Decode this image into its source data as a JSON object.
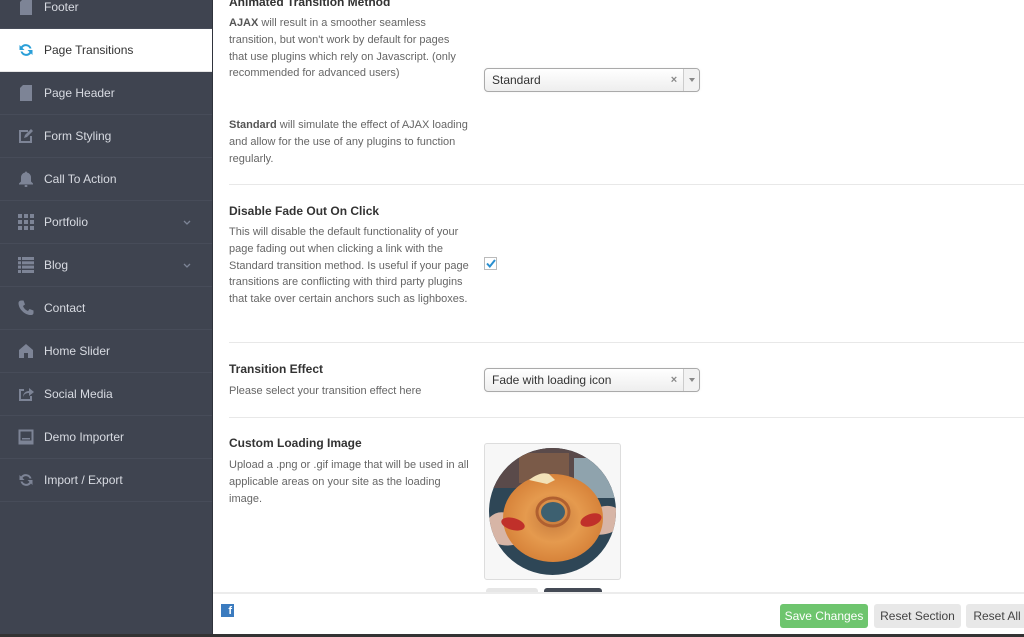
{
  "sidebar": {
    "items": [
      {
        "label": "Footer",
        "icon": "page-icon",
        "active": false
      },
      {
        "label": "Page Transitions",
        "icon": "refresh-icon",
        "active": true
      },
      {
        "label": "Page Header",
        "icon": "page-icon",
        "active": false
      },
      {
        "label": "Form Styling",
        "icon": "edit-icon",
        "active": false
      },
      {
        "label": "Call To Action",
        "icon": "bell-icon",
        "active": false
      },
      {
        "label": "Portfolio",
        "icon": "grid-icon",
        "active": false,
        "expandable": true
      },
      {
        "label": "Blog",
        "icon": "list-icon",
        "active": false,
        "expandable": true
      },
      {
        "label": "Contact",
        "icon": "phone-icon",
        "active": false
      },
      {
        "label": "Home Slider",
        "icon": "home-icon",
        "active": false
      },
      {
        "label": "Social Media",
        "icon": "share-icon",
        "active": false
      },
      {
        "label": "Demo Importer",
        "icon": "window-icon",
        "active": false
      },
      {
        "label": "Import / Export",
        "icon": "refresh-icon",
        "active": false
      }
    ]
  },
  "settings": {
    "transition_method": {
      "title": "Animated Transition Method",
      "desc_ajax_bold": "AJAX",
      "desc_ajax": " will result in a smoother seamless transition, but won't work by default for pages that use plugins which rely on Javascript. (only recommended for advanced users)",
      "desc_standard_bold": "Standard",
      "desc_standard": " will simulate the effect of AJAX loading and allow for the use of any plugins to function regularly.",
      "value": "Standard",
      "clear": "×"
    },
    "disable_fade": {
      "title": "Disable Fade Out On Click",
      "desc": "This will disable the default functionality of your page fading out when clicking a link with the Standard transition method. Is useful if your page transitions are conflicting with third party plugins that take over certain anchors such as lighboxes.",
      "checked": true
    },
    "transition_effect": {
      "title": "Transition Effect",
      "desc": "Please select your transition effect here",
      "value": "Fade with loading icon",
      "clear": "×"
    },
    "loading_image": {
      "title": "Custom Loading Image",
      "desc": "Upload a .png or .gif image that will be used in all applicable areas on your site as the loading image."
    }
  },
  "footer": {
    "social_icon": "facebook-icon",
    "fb_glyph": "f",
    "save_label": "Save Changes",
    "reset_section_label": "Reset Section",
    "reset_all_label": "Reset All"
  },
  "colors": {
    "sidebar_bg": "#3f4450",
    "accent_blue": "#2a9fd8",
    "save_green": "#6ec56e"
  }
}
